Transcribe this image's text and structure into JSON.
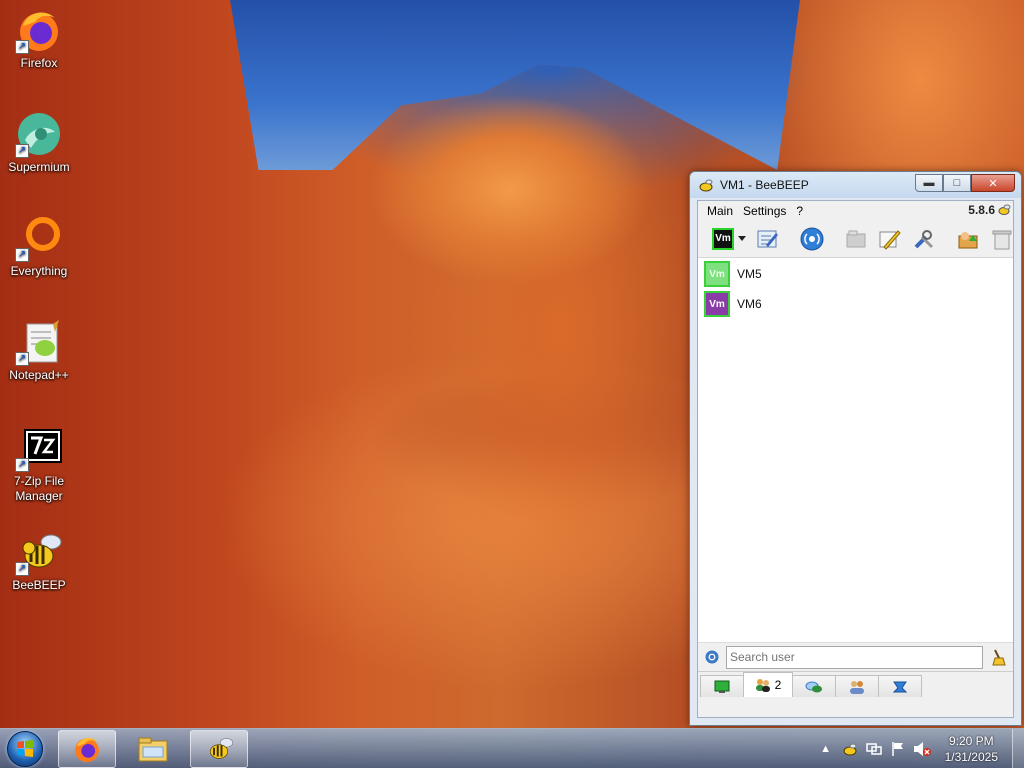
{
  "desktop": {
    "icons": [
      {
        "label": "Firefox",
        "icon": "firefox-icon"
      },
      {
        "label": "Supermium",
        "icon": "supermium-icon"
      },
      {
        "label": "Everything",
        "icon": "everything-icon"
      },
      {
        "label": "Notepad++",
        "icon": "notepadpp-icon"
      },
      {
        "label": "7-Zip File Manager",
        "icon": "7zip-icon"
      },
      {
        "label": "BeeBEEP",
        "icon": "beebeep-icon"
      }
    ]
  },
  "window": {
    "title": "VM1 - BeeBEEP",
    "menu": [
      "Main",
      "Settings",
      "?"
    ],
    "version": "5.8.6",
    "status_badge_text": "Vm",
    "users": [
      {
        "name": "VM5",
        "avatar_text": "Vm",
        "avatar_color": "#7ee07e",
        "border_color": "#3ccf3c"
      },
      {
        "name": "VM6",
        "avatar_text": "Vm",
        "avatar_color": "#8a3ca6",
        "border_color": "#3ccf3c"
      }
    ],
    "search_placeholder": "Search user",
    "tabs": [
      {
        "icon": "chat-monitor-icon",
        "label": ""
      },
      {
        "icon": "users-icon",
        "label": "2"
      },
      {
        "icon": "chats-icon",
        "label": ""
      },
      {
        "icon": "groups-icon",
        "label": ""
      },
      {
        "icon": "files-icon",
        "label": ""
      }
    ]
  },
  "taskbar": {
    "time": "9:20 PM",
    "date": "1/31/2025"
  },
  "colors": {
    "accent": "#2bd22b",
    "titlebar": "#c5d8ee"
  }
}
